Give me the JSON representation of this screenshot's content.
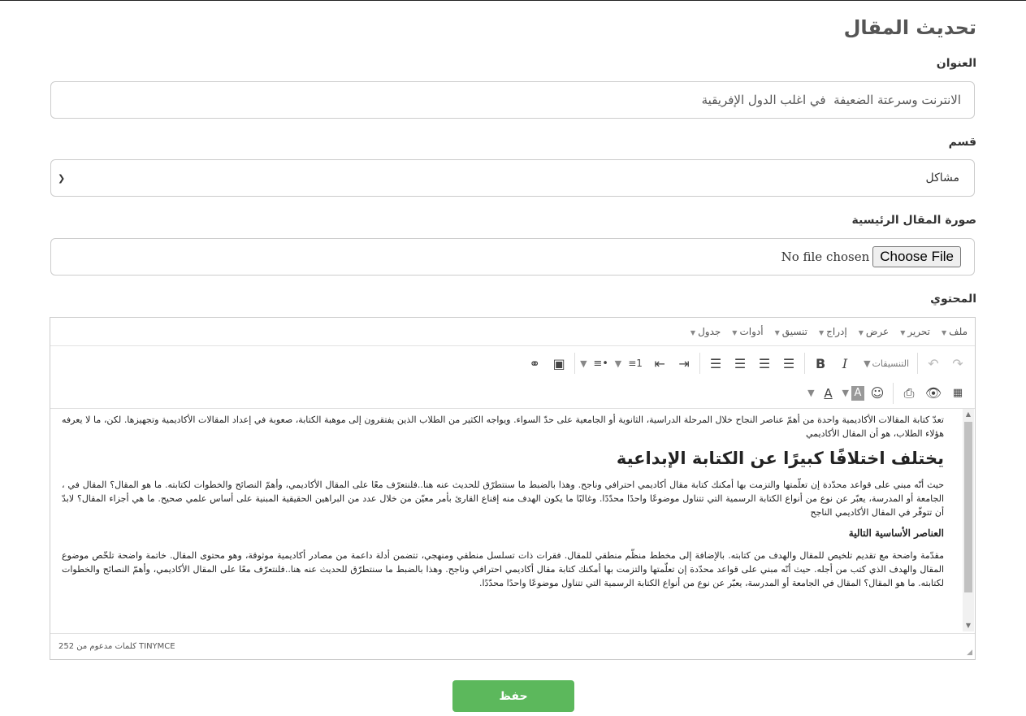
{
  "page": {
    "title": "تحديث المقال"
  },
  "form": {
    "title_label": "العنوان",
    "title_value": "الانترنت وسرعتة الضعيفة  في اغلب الدول الإفريقية",
    "category_label": "قسم",
    "category_value": "مشاكل",
    "image_label": "صورة المقال الرئيسية",
    "file_button": "Choose File",
    "file_status": "No file chosen",
    "content_label": "المحتوي",
    "save_label": "حفظ"
  },
  "editor": {
    "menu": [
      "ملف",
      "تحرير",
      "عرض",
      "إدراج",
      "تنسيق",
      "أدوات",
      "جدول"
    ],
    "formats_label": "التنسيقات",
    "content": {
      "p1": "تعدّ كتابة المقالات الأكاديمية واحدة من أهمّ عناصر النجاح خلال المرحلة الدراسية، الثانوية أو الجامعية على حدّ السواء. ويواجه الكثير من الطلاب الذين يفتقرون إلى موهبة الكتابة، صعوبة في إعداد المقالات الأكاديمية وتجهيزها. لكن، ما لا يعرفه هؤلاء الطلاب، هو أن المقال الأكاديمي",
      "h2": "يختلف اختلافًا كبيرًا عن الكتابة الإبداعية",
      "p2": "حيث أنّه مبني على قواعد محدّدة إن تعلّمتها والتزمت بها أمكنك كتابة مقال أكاديمي احترافي وناجح. وهذا بالضبط ما سنتطرّق للحديث عنه هنا..فلنتعرّف معًا على المقال الأكاديمي، وأهمّ النصائح والخطوات لكتابته. ما هو المقال؟ المقال في ، الجامعة أو المدرسة، يعبّر عن نوع من أنواع الكتابة الرسمية التي تتناول موضوعًا واحدًا محدّدًا. وغالبًا ما يكون الهدف منه إقناع القارئ بأمر معيّن من خلال عدد من البراهين الحقيقية المبنية على أساس علمي صحيح. ما هي أجزاء المقال؟ لابدّ أن تتوفّر في المقال الأكاديمي الناجح",
      "h4": "العناصر الأساسية التالية",
      "p3": "مقدّمة واضحة مع تقديم تلخيص للمقال والهدف من كتابته. بالإضافة إلى مخطط منظّم منطقي للمقال. فقرات ذات تسلسل منطقي ومنهجي، تتضمن أدلة داعمة من مصادر أكاديمية موثوقة، وهو محتوى المقال. خاتمة واضحة تلخّص موضوع المقال والهدف الذي كتب من أجله. حيث أنّه مبني على قواعد محدّدة إن تعلّمتها والتزمت بها أمكنك كتابة مقال أكاديمي احترافي وناجح. وهذا بالضبط ما سنتطرّق للحديث عنه هنا..فلنتعرّف معًا على المقال الأكاديمي، وأهمّ النصائح والخطوات لكتابته. ما هو المقال؟ المقال في الجامعة أو المدرسة، يعبّر عن نوع من أنواع الكتابة الرسمية التي تتناول موضوعًا واحدًا محدّدًا."
    },
    "status": "252 كلمات مدعوم من TINYMCE"
  }
}
